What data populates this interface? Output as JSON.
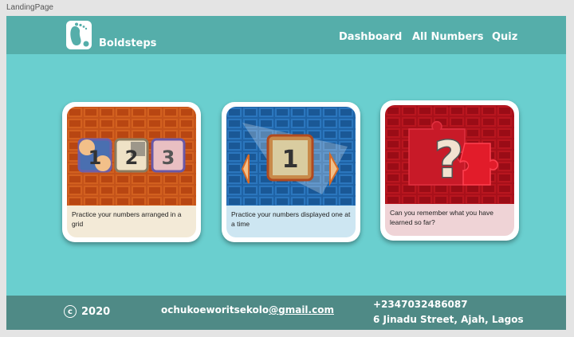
{
  "frame_label": "LandingPage",
  "header": {
    "brand": "Boldsteps",
    "nav": [
      "Dashboard",
      "All Numbers",
      "Quiz"
    ]
  },
  "cards": [
    {
      "caption": "Practice  your numbers arranged in a grid",
      "tiles": [
        "1",
        "2",
        "3"
      ]
    },
    {
      "caption": "Practice  your numbers displayed one at a time",
      "tile": "1"
    },
    {
      "caption": "Can you remember what you have learned so far?",
      "symbol": "?"
    }
  ],
  "footer": {
    "copyright_symbol": "c",
    "year": "2020",
    "email_user": "ochukoeworitsekolo",
    "email_domain": "@gmail.com",
    "phone": "+2347032486087",
    "address": "6 Jinadu Street, Ajah, Lagos"
  },
  "colors": {
    "page_bg": "#6acfcf",
    "header_bg": "#55aeaa",
    "footer_bg": "#4f8a86"
  }
}
